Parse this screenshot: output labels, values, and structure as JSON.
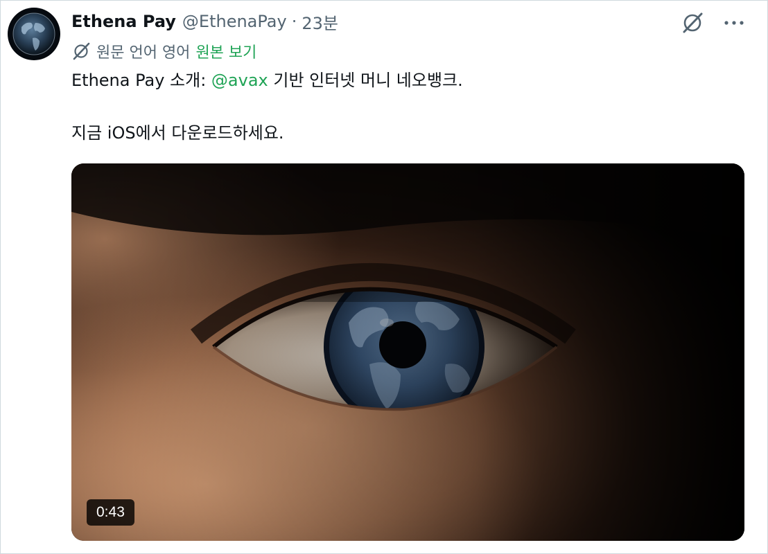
{
  "tweet": {
    "display_name": "Ethena Pay",
    "handle": "@EthenaPay",
    "separator": "·",
    "time": "23분",
    "avatar_icon": "globe-avatar-icon",
    "translation": {
      "icon": "grok-translate-icon",
      "note": "원문 언어 영어",
      "show_original": "원본 보기"
    },
    "text": {
      "line1_prefix": "Ethena Pay 소개: ",
      "mention": "@avax",
      "line1_suffix": " 기반 인터넷 머니 네오뱅크.",
      "line2": "지금 iOS에서 다운로드하세요."
    },
    "media": {
      "type": "video",
      "duration": "0:43"
    }
  },
  "actions": {
    "grok_icon": "grok-icon",
    "more_icon": "more-icon"
  },
  "colors": {
    "link": "#1fa355",
    "secondary_text": "#536471",
    "primary_text": "#0f1419"
  }
}
